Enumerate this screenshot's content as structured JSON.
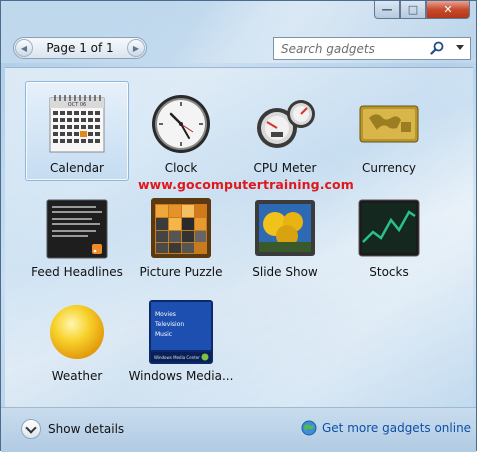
{
  "window": {
    "caption": {
      "minimize": "—",
      "maximize": "□",
      "close": "✕"
    }
  },
  "pager": {
    "text": "Page 1 of 1",
    "prev": "◀",
    "next": "▶"
  },
  "search": {
    "placeholder": "Search gadgets"
  },
  "gadgets": [
    {
      "label": "Calendar",
      "icon": "calendar-icon",
      "selected": true
    },
    {
      "label": "Clock",
      "icon": "clock-icon"
    },
    {
      "label": "CPU Meter",
      "icon": "cpu-meter-icon"
    },
    {
      "label": "Currency",
      "icon": "currency-icon"
    },
    {
      "label": "Feed Headlines",
      "icon": "feed-headlines-icon"
    },
    {
      "label": "Picture Puzzle",
      "icon": "picture-puzzle-icon"
    },
    {
      "label": "Slide Show",
      "icon": "slide-show-icon"
    },
    {
      "label": "Stocks",
      "icon": "stocks-icon"
    },
    {
      "label": "Weather",
      "icon": "weather-icon"
    },
    {
      "label": "Windows Media...",
      "icon": "windows-media-center-icon"
    }
  ],
  "calendar_icon": {
    "month": "OCT 06",
    "highlight_day": "24"
  },
  "media_icon": {
    "items": [
      "Movies",
      "Television",
      "Music"
    ],
    "caption": "Windows Media Center"
  },
  "watermark": "www.gocomputertraining.com",
  "footer": {
    "show_details": "Show details",
    "get_more": "Get more gadgets online"
  },
  "colors": {
    "watermark": "#e0171b",
    "link": "#0f4fa8",
    "selected_bg": "#c5dcf1"
  }
}
